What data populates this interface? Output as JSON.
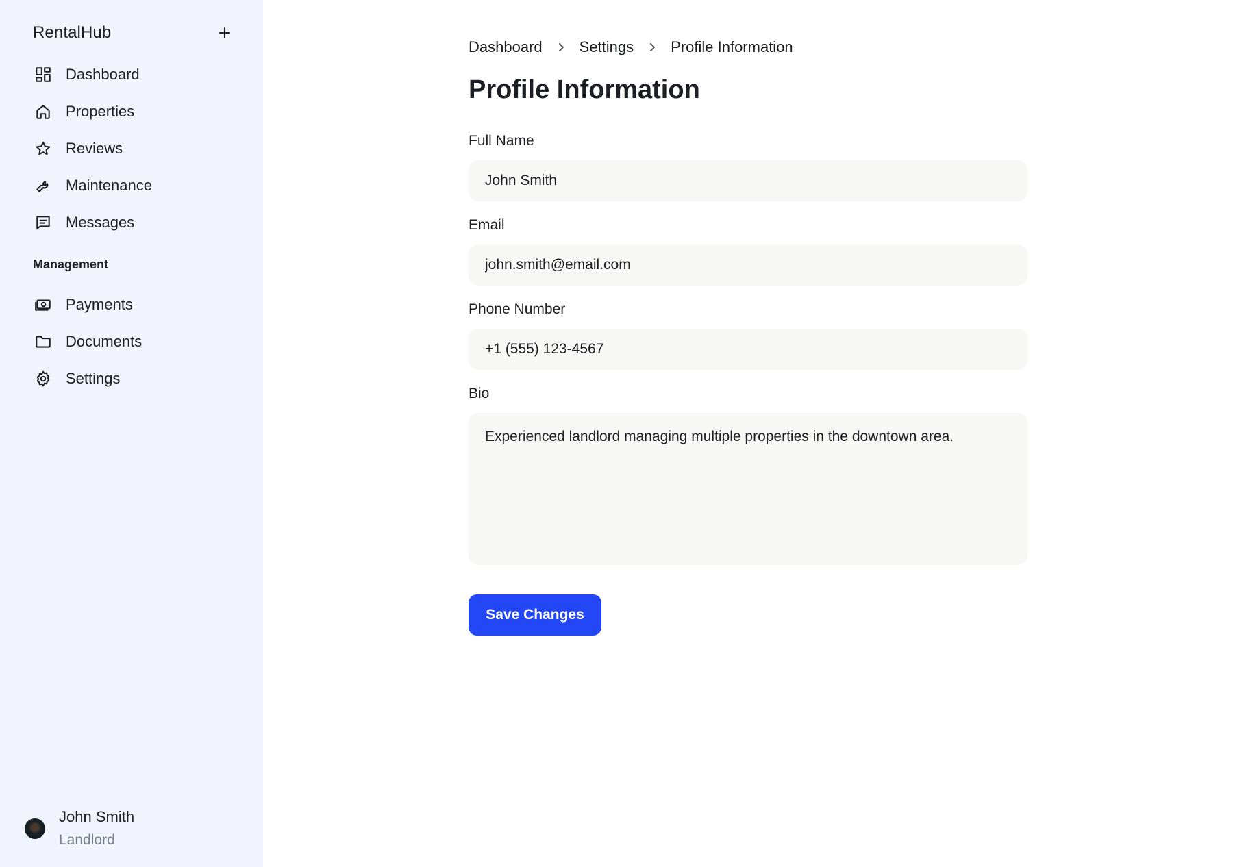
{
  "brand": {
    "name": "RentalHub",
    "add_icon": "plus-icon"
  },
  "sidebar": {
    "items": [
      {
        "label": "Dashboard",
        "icon": "dashboard-icon"
      },
      {
        "label": "Properties",
        "icon": "home-icon"
      },
      {
        "label": "Reviews",
        "icon": "star-icon"
      },
      {
        "label": "Maintenance",
        "icon": "wrench-icon"
      },
      {
        "label": "Messages",
        "icon": "message-icon"
      }
    ],
    "section_title": "Management",
    "management_items": [
      {
        "label": "Payments",
        "icon": "cash-icon"
      },
      {
        "label": "Documents",
        "icon": "folder-icon"
      },
      {
        "label": "Settings",
        "icon": "gear-icon"
      }
    ]
  },
  "user": {
    "name": "John Smith",
    "role": "Landlord"
  },
  "breadcrumb": [
    "Dashboard",
    "Settings",
    "Profile Information"
  ],
  "page": {
    "title": "Profile Information"
  },
  "form": {
    "full_name": {
      "label": "Full Name",
      "value": "John Smith"
    },
    "email": {
      "label": "Email",
      "value": "john.smith@email.com"
    },
    "phone": {
      "label": "Phone Number",
      "value": "+1 (555) 123-4567"
    },
    "bio": {
      "label": "Bio",
      "value": "Experienced landlord managing multiple properties in the downtown area."
    },
    "save_label": "Save Changes"
  },
  "colors": {
    "sidebar_bg": "#f1f4fd",
    "accent": "#2447f5",
    "input_bg": "#f7f7f5",
    "muted_text": "#7b7f86"
  }
}
